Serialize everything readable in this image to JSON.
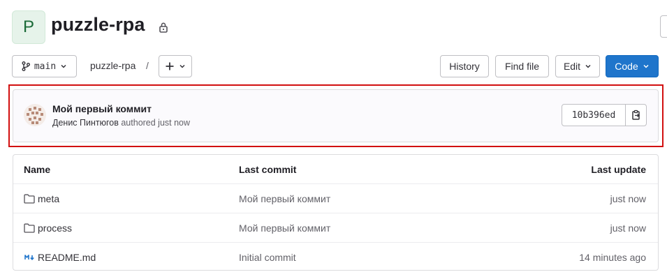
{
  "project": {
    "avatar_letter": "P",
    "name": "puzzle-rpa"
  },
  "toolbar": {
    "branch": "main",
    "breadcrumb": "puzzle-rpa",
    "breadcrumb_sep": "/",
    "history_label": "History",
    "find_file_label": "Find file",
    "edit_label": "Edit",
    "code_label": "Code"
  },
  "commit": {
    "title": "Мой первый коммит",
    "author": "Денис Пинтюгов",
    "authored_text": "authored just now",
    "sha": "10b396ed"
  },
  "table": {
    "headers": {
      "name": "Name",
      "last_commit": "Last commit",
      "last_update": "Last update"
    },
    "rows": [
      {
        "icon": "folder-icon",
        "name": "meta",
        "last_commit": "Мой первый коммит",
        "last_update": "just now"
      },
      {
        "icon": "folder-icon",
        "name": "process",
        "last_commit": "Мой первый коммит",
        "last_update": "just now"
      },
      {
        "icon": "markdown-icon",
        "name": "README.md",
        "last_commit": "Initial commit",
        "last_update": "14 minutes ago"
      }
    ]
  },
  "colors": {
    "primary": "#1f75cb",
    "highlight": "#d21010",
    "avatar_bg": "#e6f3ea"
  }
}
